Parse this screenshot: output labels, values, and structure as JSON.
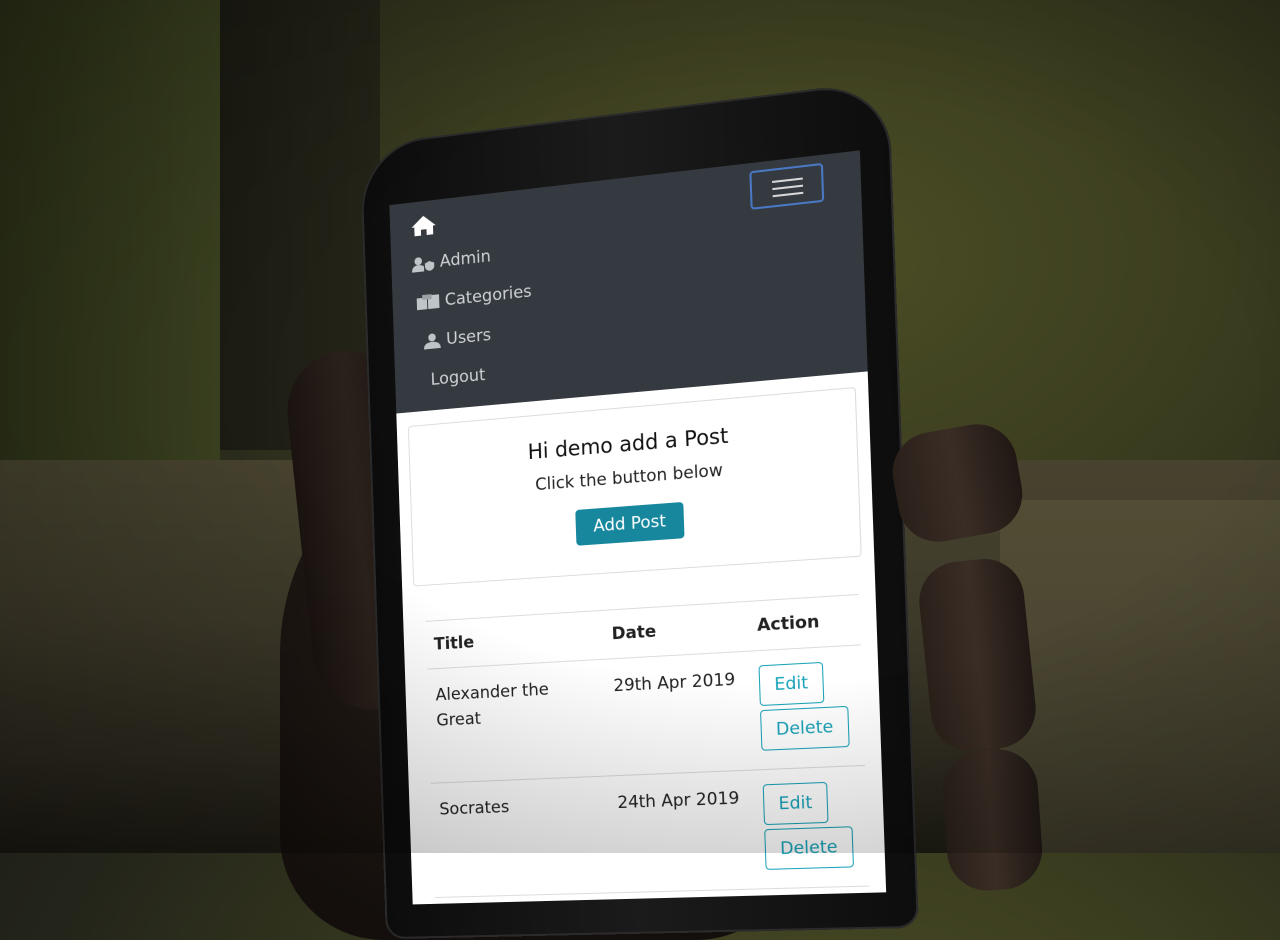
{
  "nav": {
    "items": [
      {
        "label": "Admin",
        "icon": "user-shield-icon"
      },
      {
        "label": "Categories",
        "icon": "boxes-icon"
      },
      {
        "label": "Users",
        "icon": "user-icon"
      },
      {
        "label": "Logout",
        "icon": ""
      }
    ]
  },
  "card": {
    "title": "Hi demo add a Post",
    "subtitle": "Click the button below",
    "button": "Add Post"
  },
  "table": {
    "headers": [
      "Title",
      "Date",
      "Action"
    ],
    "rows": [
      {
        "title": "Alexander the Great",
        "date": "29th Apr 2019",
        "edit": "Edit",
        "delete": "Delete"
      },
      {
        "title": "Socrates",
        "date": "24th Apr 2019",
        "edit": "Edit",
        "delete": "Delete"
      }
    ]
  },
  "colors": {
    "navbar": "#343a40",
    "primary": "#17879e",
    "outline": "#17a2b8"
  }
}
